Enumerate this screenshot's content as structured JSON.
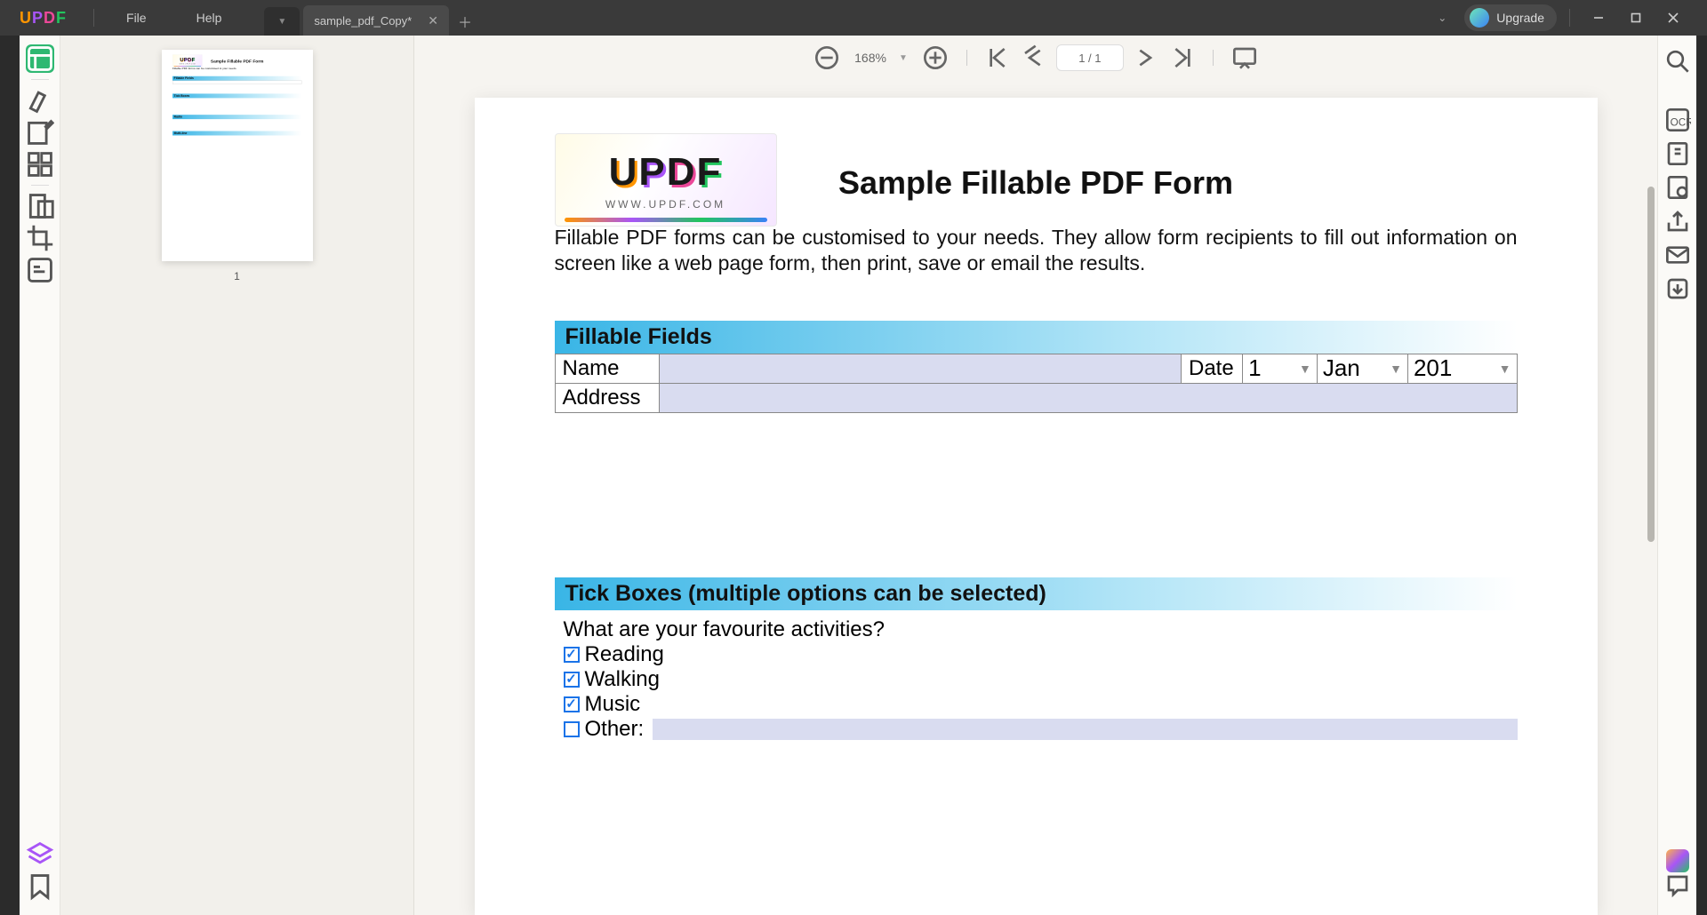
{
  "app": {
    "menu_file": "File",
    "menu_help": "Help",
    "tab_title": "sample_pdf_Copy*",
    "upgrade_label": "Upgrade"
  },
  "topbar": {
    "zoom": "168%",
    "page_indicator": "1 / 1"
  },
  "thumbnails": {
    "page1_number": "1"
  },
  "doc": {
    "logo_url": "WWW.UPDF.COM",
    "title": "Sample Fillable PDF Form",
    "paragraph": "Fillable PDF forms can be customised to your needs. They allow form recipients to fill out information on screen like a web page form, then print, save or email the results.",
    "section_fillable": "Fillable Fields",
    "label_name": "Name",
    "label_date": "Date",
    "label_address": "Address",
    "date_day": "1",
    "date_month": "Jan",
    "date_year": "201",
    "section_tickboxes": "Tick Boxes (multiple options can be selected)",
    "question_activities": "What are your favourite activities?",
    "cb_reading": "Reading",
    "cb_walking": "Walking",
    "cb_music": "Music",
    "cb_other": "Other:"
  }
}
